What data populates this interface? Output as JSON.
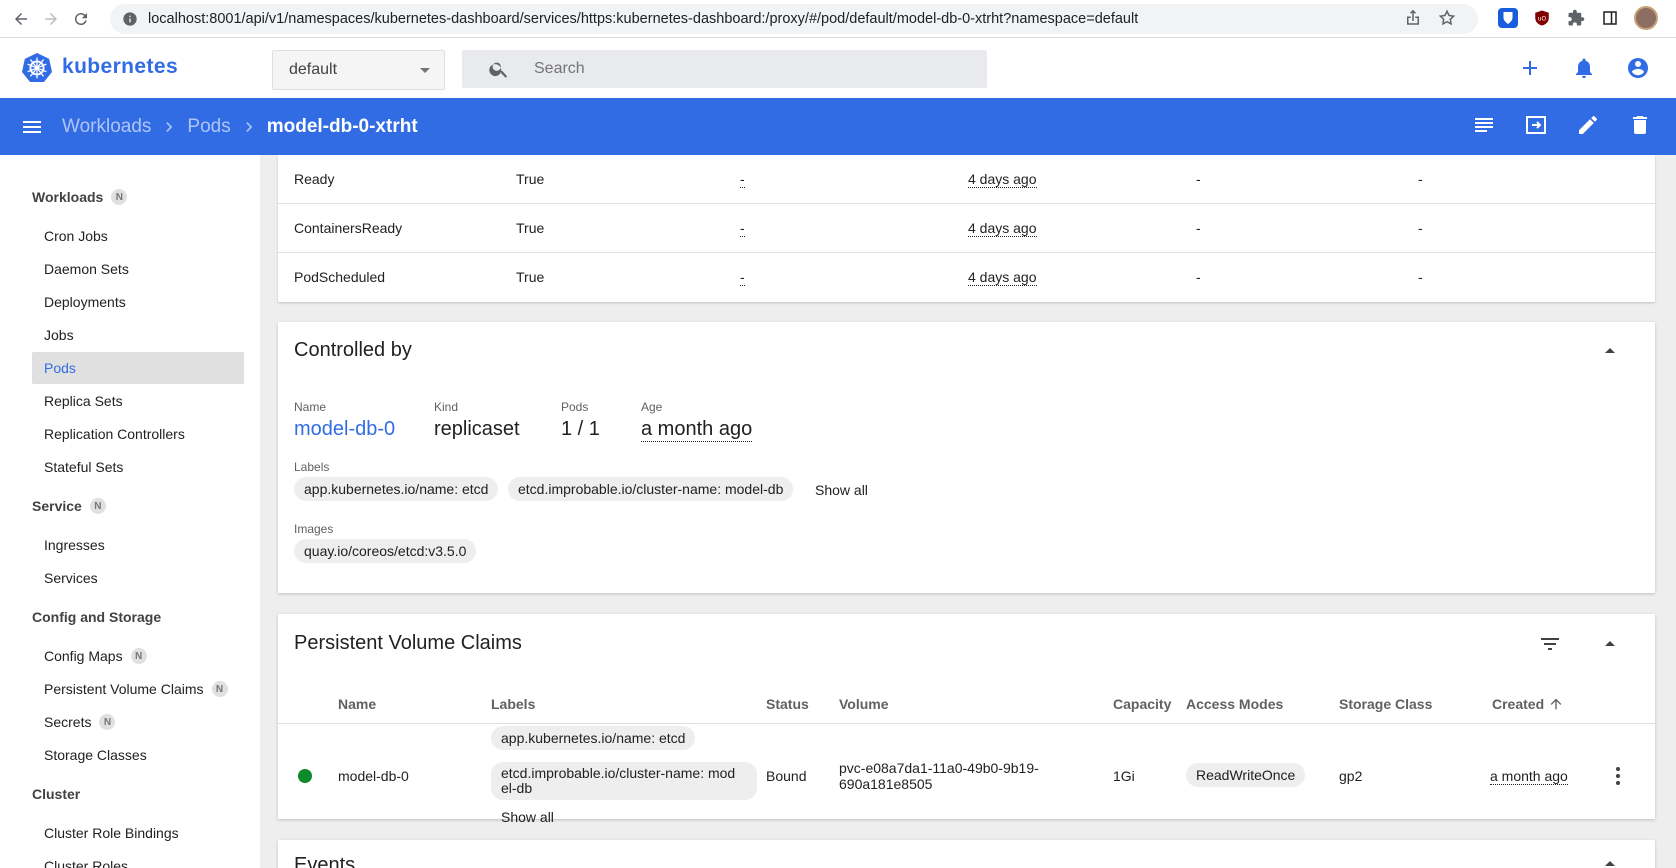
{
  "browser": {
    "url": "localhost:8001/api/v1/namespaces/kubernetes-dashboard/services/https:kubernetes-dashboard:/proxy/#/pod/default/model-db-0-xtrht?namespace=default"
  },
  "app": {
    "brand": "kubernetes",
    "namespace": "default",
    "search_placeholder": "Search",
    "accent": "#326ce5"
  },
  "breadcrumb": {
    "items": [
      "Workloads",
      "Pods"
    ],
    "current": "model-db-0-xtrht"
  },
  "sidebar": {
    "workloads": {
      "title": "Workloads",
      "badge": "N",
      "items": [
        "Cron Jobs",
        "Daemon Sets",
        "Deployments",
        "Jobs",
        "Pods",
        "Replica Sets",
        "Replication Controllers",
        "Stateful Sets"
      ]
    },
    "service": {
      "title": "Service",
      "badge": "N",
      "items": [
        "Ingresses",
        "Services"
      ]
    },
    "config": {
      "title": "Config and Storage",
      "items": [
        "Config Maps",
        "Persistent Volume Claims",
        "Secrets",
        "Storage Classes"
      ],
      "badges": {
        "config_maps": "N",
        "pvc": "N",
        "secrets": "N"
      }
    },
    "cluster": {
      "title": "Cluster",
      "items": [
        "Cluster Role Bindings",
        "Cluster Roles"
      ]
    }
  },
  "conditions": {
    "rows": [
      {
        "type": "Ready",
        "status": "True",
        "last_probe": "-",
        "last_transition": "4 days ago",
        "reason": "-",
        "message": "-"
      },
      {
        "type": "ContainersReady",
        "status": "True",
        "last_probe": "-",
        "last_transition": "4 days ago",
        "reason": "-",
        "message": "-"
      },
      {
        "type": "PodScheduled",
        "status": "True",
        "last_probe": "-",
        "last_transition": "4 days ago",
        "reason": "-",
        "message": "-"
      }
    ]
  },
  "controlled_by": {
    "title": "Controlled by",
    "name_label": "Name",
    "name": "model-db-0",
    "kind_label": "Kind",
    "kind": "replicaset",
    "pods_label": "Pods",
    "pods": "1 / 1",
    "age_label": "Age",
    "age": "a month ago",
    "labels_label": "Labels",
    "labels": [
      "app.kubernetes.io/name: etcd",
      "etcd.improbable.io/cluster-name: model-db"
    ],
    "show_all": "Show all",
    "images_label": "Images",
    "images": [
      "quay.io/coreos/etcd:v3.5.0"
    ]
  },
  "pvc": {
    "title": "Persistent Volume Claims",
    "columns": [
      "Name",
      "Labels",
      "Status",
      "Volume",
      "Capacity",
      "Access Modes",
      "Storage Class",
      "Created"
    ],
    "row": {
      "status_color": "#0d8a2a",
      "name": "model-db-0",
      "labels": [
        "app.kubernetes.io/name: etcd",
        "etcd.improbable.io/cluster-name: mod",
        "el-db"
      ],
      "show_all": "Show all",
      "status": "Bound",
      "volume_line1": "pvc-e08a7da1-11a0-49b0-9b19-",
      "volume_line2": "690a181e8505",
      "capacity": "1Gi",
      "access_mode": "ReadWriteOnce",
      "storage_class": "gp2",
      "created": "a month ago"
    }
  },
  "events": {
    "title": "Events"
  }
}
